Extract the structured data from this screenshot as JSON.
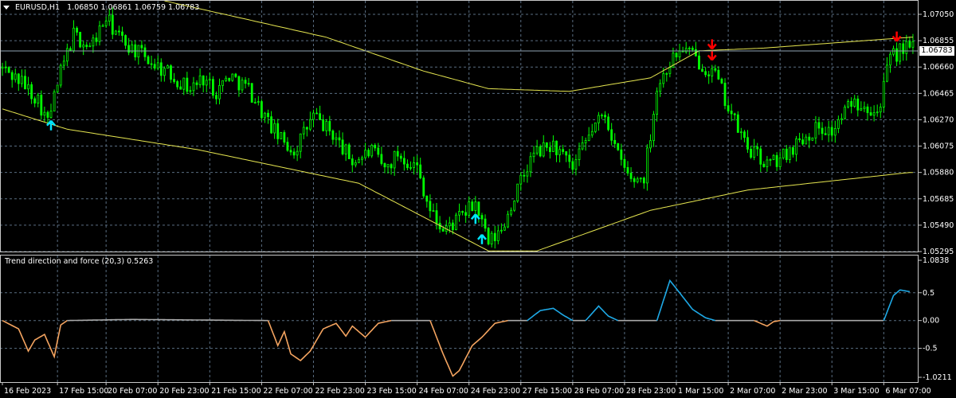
{
  "header": {
    "triangle_icon": "triangle-down-icon",
    "symbol": "EURUSD,H1",
    "ohlc": "1.06850 1.06861 1.06759 1.06783"
  },
  "current_price": "1.06783",
  "price_axis": {
    "ticks": [
      "1.07050",
      "1.06855",
      "1.06660",
      "1.06465",
      "1.06270",
      "1.06075",
      "1.05880",
      "1.05685",
      "1.05490",
      "1.05295"
    ]
  },
  "indicator": {
    "name": "Trend direction and force (20,3) 0.5263",
    "ticks": [
      "1.0838",
      "0.5",
      "0.00",
      "-0.5",
      "-1.0211"
    ]
  },
  "time_axis": {
    "labels": [
      "16 Feb 2023",
      "17 Feb 15:00",
      "20 Feb 07:00",
      "20 Feb 23:00",
      "21 Feb 15:00",
      "22 Feb 07:00",
      "22 Feb 23:00",
      "23 Feb 15:00",
      "24 Feb 07:00",
      "24 Feb 23:00",
      "27 Feb 15:00",
      "28 Feb 07:00",
      "28 Feb 23:00",
      "1 Mar 15:00",
      "2 Mar 07:00",
      "2 Mar 23:00",
      "3 Mar 15:00",
      "6 Mar 07:00"
    ]
  },
  "colors": {
    "background": "#000000",
    "grid": "#5a6e82",
    "candle": "#00ff00",
    "ma": "#e6e650",
    "bid_line": "#8fa3b5",
    "arrow_up": "#00e5ff",
    "arrow_down": "#ff0000",
    "osc_up": "#1ea9e6",
    "osc_down": "#f4a460",
    "osc_neutral": "#a9a9a9"
  },
  "chart_data": {
    "type": "candlestick",
    "symbol": "EURUSD",
    "timeframe": "H1",
    "ylim": [
      1.05295,
      1.0715
    ],
    "close_path": {
      "x_labels_index": [
        0,
        17,
        32,
        48,
        64,
        80,
        96,
        112,
        128,
        144,
        160,
        176,
        192,
        208,
        224,
        240,
        256,
        272
      ],
      "points": [
        [
          0,
          1.0665
        ],
        [
          6,
          1.0655
        ],
        [
          11,
          1.0642
        ],
        [
          14,
          1.0625
        ],
        [
          18,
          1.0662
        ],
        [
          22,
          1.069
        ],
        [
          27,
          1.068
        ],
        [
          32,
          1.0702
        ],
        [
          36,
          1.0688
        ],
        [
          40,
          1.068
        ],
        [
          46,
          1.067
        ],
        [
          52,
          1.066
        ],
        [
          58,
          1.065
        ],
        [
          62,
          1.0658
        ],
        [
          66,
          1.0648
        ],
        [
          70,
          1.066
        ],
        [
          76,
          1.065
        ],
        [
          82,
          1.0625
        ],
        [
          86,
          1.0612
        ],
        [
          90,
          1.0604
        ],
        [
          96,
          1.063
        ],
        [
          102,
          1.0616
        ],
        [
          108,
          1.0596
        ],
        [
          114,
          1.0604
        ],
        [
          118,
          1.059
        ],
        [
          122,
          1.0602
        ],
        [
          128,
          1.0592
        ],
        [
          132,
          1.056
        ],
        [
          136,
          1.0545
        ],
        [
          140,
          1.0552
        ],
        [
          146,
          1.0565
        ],
        [
          150,
          1.0535
        ],
        [
          154,
          1.0545
        ],
        [
          158,
          1.057
        ],
        [
          164,
          1.0602
        ],
        [
          170,
          1.0608
        ],
        [
          176,
          1.059
        ],
        [
          182,
          1.062
        ],
        [
          186,
          1.0632
        ],
        [
          190,
          1.06
        ],
        [
          194,
          1.0582
        ],
        [
          198,
          1.0585
        ],
        [
          202,
          1.065
        ],
        [
          206,
          1.067
        ],
        [
          210,
          1.068
        ],
        [
          216,
          1.0668
        ],
        [
          220,
          1.066
        ],
        [
          226,
          1.0625
        ],
        [
          230,
          1.0606
        ],
        [
          236,
          1.0594
        ],
        [
          240,
          1.0598
        ],
        [
          246,
          1.0612
        ],
        [
          252,
          1.0622
        ],
        [
          256,
          1.0618
        ],
        [
          262,
          1.064
        ],
        [
          266,
          1.064
        ],
        [
          270,
          1.0632
        ],
        [
          274,
          1.0672
        ],
        [
          278,
          1.068
        ]
      ]
    },
    "moving_averages": [
      {
        "points": [
          [
            0,
            1.0635
          ],
          [
            20,
            1.062
          ],
          [
            60,
            1.0605
          ],
          [
            110,
            1.058
          ],
          [
            150,
            1.053
          ],
          [
            165,
            1.053
          ],
          [
            200,
            1.056
          ],
          [
            230,
            1.0575
          ],
          [
            280,
            1.0588
          ]
        ]
      },
      {
        "points": [
          [
            50,
            1.0715
          ],
          [
            100,
            1.0688
          ],
          [
            130,
            1.0663
          ],
          [
            150,
            1.065
          ],
          [
            175,
            1.0648
          ],
          [
            200,
            1.0658
          ],
          [
            215,
            1.0678
          ],
          [
            235,
            1.068
          ],
          [
            280,
            1.0688
          ]
        ]
      }
    ],
    "signals": [
      {
        "index": 15,
        "direction": "up"
      },
      {
        "index": 146,
        "direction": "up"
      },
      {
        "index": 148,
        "direction": "up"
      },
      {
        "index": 219,
        "direction": "down"
      },
      {
        "index": 219,
        "direction": "down"
      },
      {
        "index": 276,
        "direction": "down"
      }
    ],
    "oscillator": {
      "ylim": [
        -1.0211,
        1.0838
      ],
      "series": [
        {
          "state": "down",
          "points": [
            [
              0,
              0.0
            ],
            [
              5,
              -0.15
            ],
            [
              8,
              -0.55
            ],
            [
              10,
              -0.35
            ],
            [
              13,
              -0.25
            ],
            [
              16,
              -0.65
            ],
            [
              18,
              -0.08
            ],
            [
              20,
              0.0
            ]
          ]
        },
        {
          "state": "neutral",
          "points": [
            [
              20,
              0.0
            ],
            [
              40,
              0.02
            ],
            [
              60,
              0.01
            ],
            [
              82,
              0.0
            ]
          ]
        },
        {
          "state": "down",
          "points": [
            [
              82,
              0.0
            ],
            [
              85,
              -0.45
            ],
            [
              87,
              -0.2
            ],
            [
              89,
              -0.6
            ],
            [
              92,
              -0.72
            ],
            [
              95,
              -0.55
            ],
            [
              99,
              -0.15
            ],
            [
              103,
              -0.05
            ],
            [
              106,
              -0.28
            ],
            [
              108,
              -0.1
            ],
            [
              112,
              -0.3
            ],
            [
              116,
              -0.05
            ],
            [
              120,
              0.0
            ]
          ]
        },
        {
          "state": "neutral",
          "points": [
            [
              120,
              0.0
            ],
            [
              132,
              0.0
            ]
          ]
        },
        {
          "state": "down",
          "points": [
            [
              132,
              0.0
            ],
            [
              136,
              -0.6
            ],
            [
              139,
              -1.0
            ],
            [
              141,
              -0.9
            ],
            [
              145,
              -0.45
            ],
            [
              148,
              -0.3
            ],
            [
              152,
              -0.05
            ],
            [
              156,
              0.0
            ]
          ]
        },
        {
          "state": "neutral",
          "points": [
            [
              156,
              0.0
            ],
            [
              162,
              0.0
            ]
          ]
        },
        {
          "state": "up",
          "points": [
            [
              162,
              0.0
            ],
            [
              166,
              0.18
            ],
            [
              170,
              0.22
            ],
            [
              173,
              0.1
            ],
            [
              176,
              0.0
            ]
          ]
        },
        {
          "state": "neutral",
          "points": [
            [
              176,
              0.0
            ],
            [
              180,
              0.0
            ]
          ]
        },
        {
          "state": "up",
          "points": [
            [
              180,
              0.0
            ],
            [
              184,
              0.26
            ],
            [
              187,
              0.08
            ],
            [
              190,
              0.0
            ]
          ]
        },
        {
          "state": "neutral",
          "points": [
            [
              190,
              0.0
            ],
            [
              202,
              0.0
            ]
          ]
        },
        {
          "state": "up",
          "points": [
            [
              202,
              0.0
            ],
            [
              206,
              0.72
            ],
            [
              209,
              0.5
            ],
            [
              213,
              0.2
            ],
            [
              217,
              0.05
            ],
            [
              220,
              0.0
            ]
          ]
        },
        {
          "state": "neutral",
          "points": [
            [
              220,
              0.0
            ],
            [
              232,
              0.0
            ]
          ]
        },
        {
          "state": "down",
          "points": [
            [
              232,
              0.0
            ],
            [
              236,
              -0.1
            ],
            [
              238,
              -0.02
            ],
            [
              240,
              0.0
            ]
          ]
        },
        {
          "state": "neutral",
          "points": [
            [
              240,
              0.0
            ],
            [
              272,
              0.0
            ]
          ]
        },
        {
          "state": "up",
          "points": [
            [
              272,
              0.0
            ],
            [
              275,
              0.45
            ],
            [
              277,
              0.55
            ],
            [
              280,
              0.52
            ]
          ]
        }
      ]
    }
  }
}
